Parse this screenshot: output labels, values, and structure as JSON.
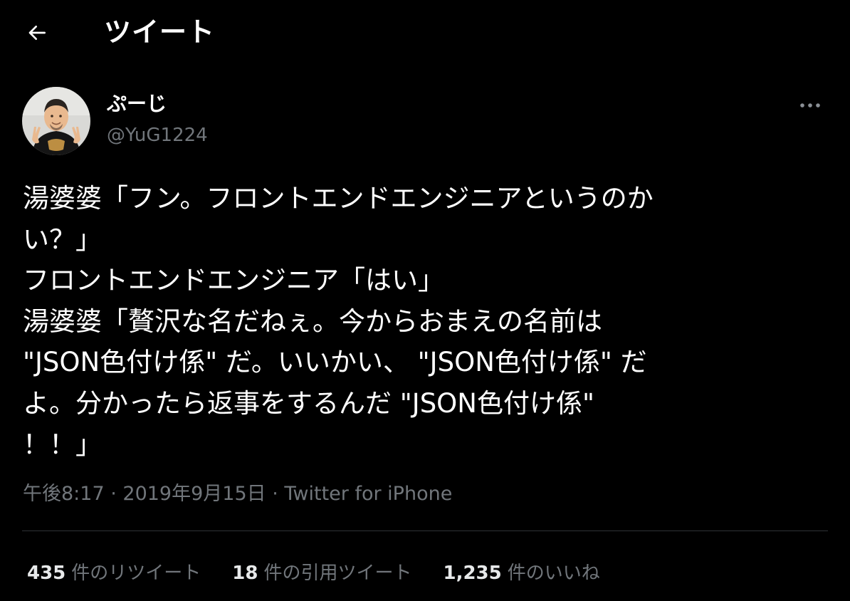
{
  "header": {
    "title": "ツイート",
    "back_icon": "arrow-left-icon"
  },
  "author": {
    "display_name": "ぷーじ",
    "handle": "@YuG1224",
    "more_icon": "more-horizontal-icon"
  },
  "tweet": {
    "lines": [
      "湯婆婆「フン。フロントエンドエンジニアというのか",
      "い？」",
      "フロントエンドエンジニア「はい」",
      "湯婆婆「贅沢な名だねぇ。今からおまえの名前は",
      "\"JSON色付け係\" だ。いいかい、 \"JSON色付け係\" だ",
      "よ。分かったら返事をするんだ \"JSON色付け係\"",
      "！！」"
    ]
  },
  "meta": {
    "time": "午後8:17",
    "separator": " · ",
    "date": "2019年9月15日",
    "source": "Twitter for iPhone"
  },
  "stats": {
    "retweets_count": "435",
    "retweets_label": "件のリツイート",
    "quotes_count": "18",
    "quotes_label": "件の引用ツイート",
    "likes_count": "1,235",
    "likes_label": "件のいいね"
  },
  "colors": {
    "background": "#000000",
    "text": "#ffffff",
    "secondary": "#71767b",
    "divider": "#2f3336"
  }
}
